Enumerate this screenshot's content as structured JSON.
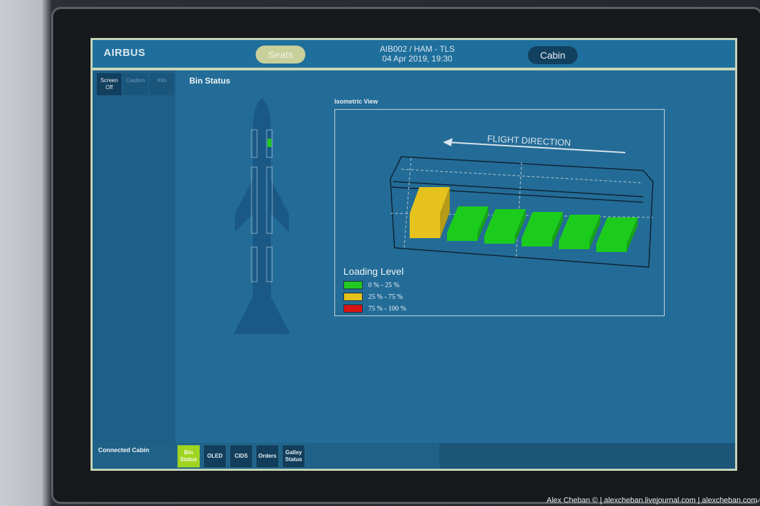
{
  "header": {
    "brand": "AIRBUS",
    "seats_label": "Seats",
    "flight_line": "AIB002  / HAM - TLS",
    "date_line": "04 Apr 2019, 19:30",
    "cabin_label": "Cabin"
  },
  "sidebar": {
    "tabs": [
      {
        "line1": "Screen",
        "line2": "Off"
      },
      {
        "line1": "Caution",
        "line2": ""
      },
      {
        "line1": "Info",
        "line2": ""
      }
    ]
  },
  "main": {
    "title": "Bin Status",
    "iso_label": "Isometric View",
    "flight_direction": "FLIGHT DIRECTION",
    "bins": [
      {
        "level": "25 % - 75 %",
        "color": "#e5c21c"
      },
      {
        "level": "0 % - 25 %",
        "color": "#1ccc1c"
      },
      {
        "level": "0 % - 25 %",
        "color": "#1ccc1c"
      },
      {
        "level": "0 % - 25 %",
        "color": "#1ccc1c"
      },
      {
        "level": "0 % - 25 %",
        "color": "#1ccc1c"
      },
      {
        "level": "0 % - 25 %",
        "color": "#1ccc1c"
      }
    ],
    "legend": {
      "title": "Loading Level",
      "items": [
        {
          "label": "0 % - 25 %",
          "color": "#21c821"
        },
        {
          "label": "25 % - 75 %",
          "color": "#e5c21c"
        },
        {
          "label": "75 % - 100 %",
          "color": "#d81414"
        }
      ]
    }
  },
  "bottom": {
    "connected_label": "Connected Cabin",
    "buttons": [
      {
        "line1": "Bin",
        "line2": "Status",
        "active": true
      },
      {
        "line1": "OLED",
        "line2": "",
        "active": false
      },
      {
        "line1": "CIDS",
        "line2": "",
        "active": false
      },
      {
        "line1": "Orders",
        "line2": "",
        "active": false
      },
      {
        "line1": "Galley",
        "line2": "Status",
        "active": false
      }
    ]
  },
  "credit": "Alex Cheban © | alexcheban.livejournal.com | alexcheban.com"
}
